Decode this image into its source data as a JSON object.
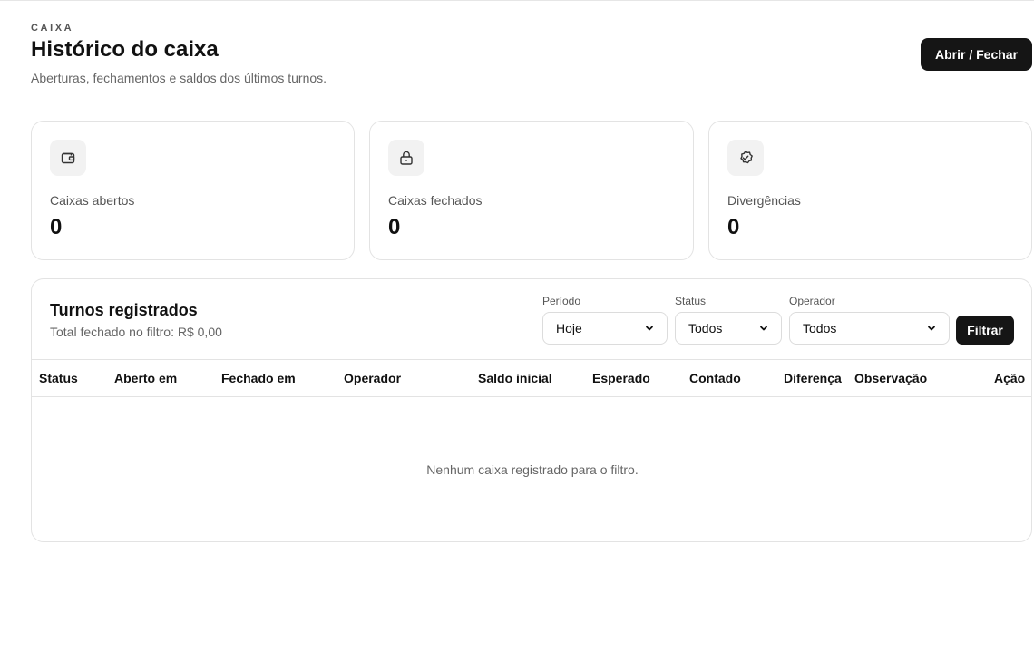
{
  "header": {
    "eyebrow": "CAIXA",
    "title": "Histórico do caixa",
    "subtitle": "Aberturas, fechamentos e saldos dos últimos turnos.",
    "primary_action": "Abrir / Fechar"
  },
  "stats": [
    {
      "icon": "wallet-icon",
      "label": "Caixas abertos",
      "value": "0"
    },
    {
      "icon": "lock-icon",
      "label": "Caixas fechados",
      "value": "0"
    },
    {
      "icon": "check-badge-icon",
      "label": "Divergências",
      "value": "0"
    }
  ],
  "panel": {
    "title": "Turnos registrados",
    "subtitle": "Total fechado no filtro: R$ 0,00",
    "filters": {
      "period": {
        "label": "Período",
        "value": "Hoje"
      },
      "status": {
        "label": "Status",
        "value": "Todos"
      },
      "operator": {
        "label": "Operador",
        "value": "Todos"
      },
      "submit_label": "Filtrar"
    },
    "columns": [
      "Status",
      "Aberto em",
      "Fechado em",
      "Operador",
      "Saldo inicial",
      "Esperado",
      "Contado",
      "Diferença",
      "Observação",
      "Ação"
    ],
    "empty_message": "Nenhum caixa registrado para o filtro."
  },
  "colors": {
    "primary": "#151515",
    "border": "#e3e3e3",
    "muted_text": "#666666",
    "icon_bg": "#f2f2f2"
  }
}
